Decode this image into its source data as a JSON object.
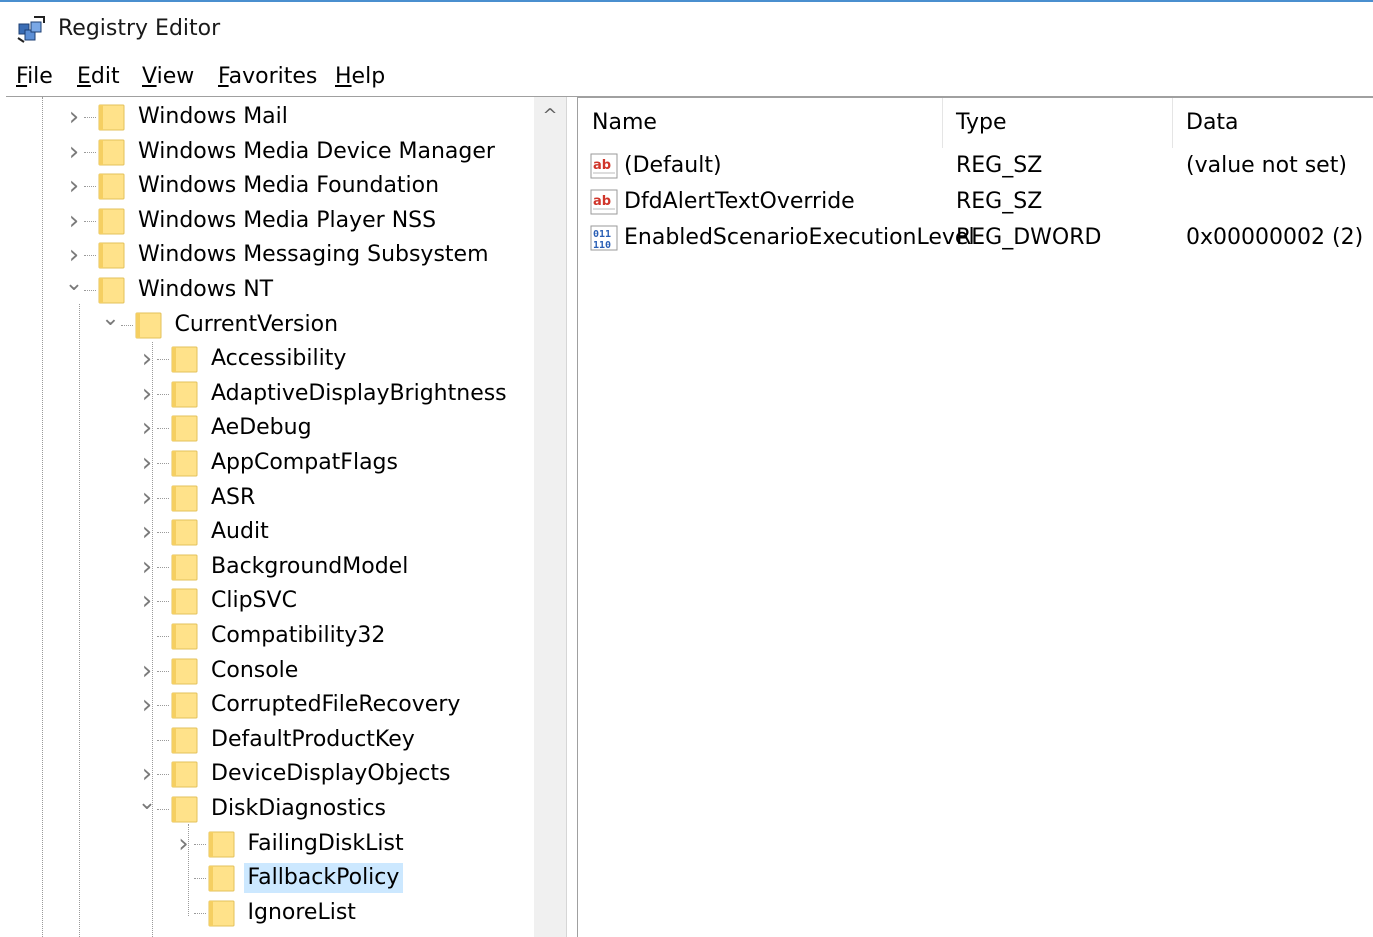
{
  "window": {
    "title": "Registry Editor",
    "accent": "#4a8fcf"
  },
  "menu": [
    "File",
    "Edit",
    "View",
    "Favorites",
    "Help"
  ],
  "tree": {
    "items": [
      {
        "label": "Windows Mail",
        "expander": "collapsed"
      },
      {
        "label": "Windows Media Device Manager",
        "expander": "collapsed"
      },
      {
        "label": "Windows Media Foundation",
        "expander": "collapsed"
      },
      {
        "label": "Windows Media Player NSS",
        "expander": "collapsed"
      },
      {
        "label": "Windows Messaging Subsystem",
        "expander": "collapsed"
      },
      {
        "label": "Windows NT",
        "expander": "expanded"
      },
      {
        "label": "CurrentVersion",
        "expander": "expanded"
      },
      {
        "label": "Accessibility",
        "expander": "collapsed"
      },
      {
        "label": "AdaptiveDisplayBrightness",
        "expander": "collapsed"
      },
      {
        "label": "AeDebug",
        "expander": "collapsed"
      },
      {
        "label": "AppCompatFlags",
        "expander": "collapsed"
      },
      {
        "label": "ASR",
        "expander": "collapsed"
      },
      {
        "label": "Audit",
        "expander": "collapsed"
      },
      {
        "label": "BackgroundModel",
        "expander": "collapsed"
      },
      {
        "label": "ClipSVC",
        "expander": "collapsed"
      },
      {
        "label": "Compatibility32",
        "expander": "none"
      },
      {
        "label": "Console",
        "expander": "collapsed"
      },
      {
        "label": "CorruptedFileRecovery",
        "expander": "collapsed"
      },
      {
        "label": "DefaultProductKey",
        "expander": "none"
      },
      {
        "label": "DeviceDisplayObjects",
        "expander": "collapsed"
      },
      {
        "label": "DiskDiagnostics",
        "expander": "expanded"
      },
      {
        "label": "FailingDiskList",
        "expander": "collapsed"
      },
      {
        "label": "FallbackPolicy",
        "expander": "none",
        "selected": true
      },
      {
        "label": "IgnoreList",
        "expander": "none"
      }
    ]
  },
  "values": {
    "columns": [
      "Name",
      "Type",
      "Data"
    ],
    "rows": [
      {
        "name": "(Default)",
        "type": "REG_SZ",
        "data": "(value not set)",
        "icon": "string-value-icon"
      },
      {
        "name": "DfdAlertTextOverride",
        "type": "REG_SZ",
        "data": "",
        "icon": "string-value-icon"
      },
      {
        "name": "EnabledScenarioExecutionLevel",
        "type": "REG_DWORD",
        "data": "0x00000002 (2)",
        "icon": "binary-value-icon"
      }
    ]
  },
  "colors": {
    "selection": "#cce8ff",
    "folder": "#ffd966",
    "string_icon": "#d0362b",
    "binary_icon": "#2a5fb5"
  }
}
